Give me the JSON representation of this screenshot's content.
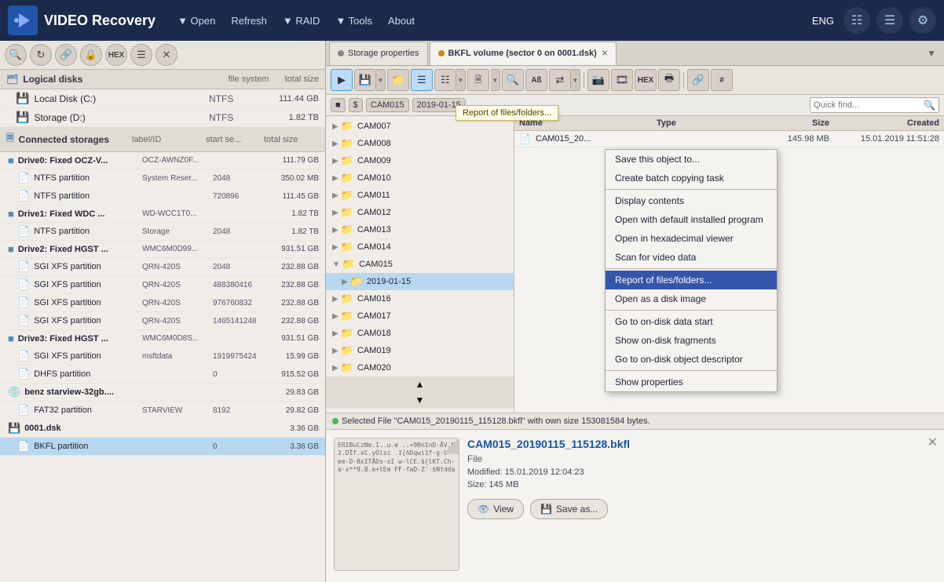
{
  "app": {
    "title": "VIDEO Recovery",
    "lang": "ENG"
  },
  "menu": {
    "items": [
      {
        "label": "▼ Open",
        "id": "open"
      },
      {
        "label": "Refresh",
        "id": "refresh"
      },
      {
        "label": "▼ RAID",
        "id": "raid"
      },
      {
        "label": "▼ Tools",
        "id": "tools"
      },
      {
        "label": "About",
        "id": "about"
      }
    ]
  },
  "left": {
    "logical_disks": {
      "header": "Logical disks",
      "cols": [
        "file system",
        "total size"
      ],
      "items": [
        {
          "name": "Local Disk (C:)",
          "icon": "💾",
          "fs": "NTFS",
          "size": "111.44 GB",
          "indent": 0
        },
        {
          "name": "Storage (D:)",
          "icon": "💾",
          "fs": "NTFS",
          "size": "1.82 TB",
          "indent": 0
        }
      ]
    },
    "connected_storages": {
      "header": "Connected storages",
      "cols": [
        "label/ID",
        "start se...",
        "total size"
      ],
      "items": [
        {
          "name": "Drive0: Fixed OCZ-V...",
          "icon": "🖴",
          "id": "OCZ-AWNZ0F...",
          "start": "",
          "size": "111.79 GB",
          "indent": 0,
          "bold": true
        },
        {
          "name": "NTFS partition",
          "icon": "📄",
          "id": "System Reser...",
          "start": "2048",
          "size": "350.02 MB",
          "indent": 1
        },
        {
          "name": "NTFS partition",
          "icon": "📄",
          "id": "",
          "start": "720896",
          "size": "111.45 GB",
          "indent": 1
        },
        {
          "name": "Drive1: Fixed WDC ...",
          "icon": "🖴",
          "id": "WD-WCC1T0...",
          "start": "",
          "size": "1.82 TB",
          "indent": 0,
          "bold": true
        },
        {
          "name": "NTFS partition",
          "icon": "📄",
          "id": "Storage",
          "start": "2048",
          "size": "1.82 TB",
          "indent": 1
        },
        {
          "name": "Drive2: Fixed HGST ...",
          "icon": "🖴",
          "id": "WMC6M0D99...",
          "start": "",
          "size": "931.51 GB",
          "indent": 0,
          "bold": true
        },
        {
          "name": "SGI XFS partition",
          "icon": "📄",
          "id": "QRN-420S",
          "start": "2048",
          "size": "232.88 GB",
          "indent": 1
        },
        {
          "name": "SGI XFS partition",
          "icon": "📄",
          "id": "QRN-420S",
          "start": "488380416",
          "size": "232.88 GB",
          "indent": 1
        },
        {
          "name": "SGI XFS partition",
          "icon": "📄",
          "id": "QRN-420S",
          "start": "976760832",
          "size": "232.88 GB",
          "indent": 1
        },
        {
          "name": "SGI XFS partition",
          "icon": "📄",
          "id": "QRN-420S",
          "start": "1465141248",
          "size": "232.88 GB",
          "indent": 1
        },
        {
          "name": "Drive3: Fixed HGST ...",
          "icon": "🖴",
          "id": "WMC6M0D8S...",
          "start": "",
          "size": "931.51 GB",
          "indent": 0,
          "bold": true
        },
        {
          "name": "SGI XFS partition",
          "icon": "📄",
          "id": "msftdata",
          "start": "1919975424",
          "size": "15.99 GB",
          "indent": 1
        },
        {
          "name": "DHFS partition",
          "icon": "📄",
          "id": "",
          "start": "0",
          "size": "915.52 GB",
          "indent": 1
        },
        {
          "name": "benz starview-32gb....",
          "icon": "💿",
          "id": "",
          "start": "",
          "size": "29.83 GB",
          "indent": 0
        },
        {
          "name": "FAT32 partition",
          "icon": "📄",
          "id": "STARVIEW",
          "start": "8192",
          "size": "29.82 GB",
          "indent": 1
        },
        {
          "name": "0001.dsk",
          "icon": "💾",
          "id": "",
          "start": "",
          "size": "3.36 GB",
          "indent": 0
        },
        {
          "name": "BKFL partition",
          "icon": "📄",
          "id": "",
          "start": "0",
          "size": "3.36 GB",
          "indent": 1,
          "selected": true
        }
      ]
    }
  },
  "tabs": [
    {
      "id": "storage-props",
      "label": "Storage properties",
      "dot_color": "#888",
      "active": false,
      "closable": false
    },
    {
      "id": "bkfl-volume",
      "label": "BKFL volume (sector 0 on 0001.dsk)",
      "dot_color": "#cc8800",
      "active": true,
      "closable": true
    }
  ],
  "path": {
    "crumbs": [
      "▪",
      "$",
      "CAM015",
      "2019-01-15"
    ],
    "search_placeholder": "Quick find...",
    "tooltip": "Report of files/folders..."
  },
  "tree": {
    "items": [
      {
        "name": "CAM007",
        "expanded": false,
        "indent": 0
      },
      {
        "name": "CAM008",
        "expanded": false,
        "indent": 0
      },
      {
        "name": "CAM009",
        "expanded": false,
        "indent": 0
      },
      {
        "name": "CAM010",
        "expanded": false,
        "indent": 0
      },
      {
        "name": "CAM011",
        "expanded": false,
        "indent": 0
      },
      {
        "name": "CAM012",
        "expanded": false,
        "indent": 0
      },
      {
        "name": "CAM013",
        "expanded": false,
        "indent": 0
      },
      {
        "name": "CAM014",
        "expanded": false,
        "indent": 0
      },
      {
        "name": "CAM015",
        "expanded": true,
        "indent": 0
      },
      {
        "name": "2019-01-15",
        "expanded": false,
        "indent": 1,
        "selected": true
      },
      {
        "name": "CAM016",
        "expanded": false,
        "indent": 0
      },
      {
        "name": "CAM017",
        "expanded": false,
        "indent": 0
      },
      {
        "name": "CAM018",
        "expanded": false,
        "indent": 0
      },
      {
        "name": "CAM019",
        "expanded": false,
        "indent": 0
      },
      {
        "name": "CAM020",
        "expanded": false,
        "indent": 0
      }
    ]
  },
  "file_list": {
    "columns": [
      "Name",
      "Type",
      "Size",
      "Created"
    ],
    "items": [
      {
        "name": "CAM015_20...",
        "icon": "📄",
        "type": "",
        "size": "145.98 MB",
        "created": "15.01.2019 11:51:28",
        "extra": "15.01..."
      }
    ]
  },
  "context_menu": {
    "items": [
      {
        "label": "Save this object to...",
        "id": "save",
        "sep_after": false
      },
      {
        "label": "Create batch copying task",
        "id": "batch",
        "sep_after": true
      },
      {
        "label": "Display contents",
        "id": "display",
        "sep_after": false
      },
      {
        "label": "Open with default installed program",
        "id": "open-default",
        "sep_after": false
      },
      {
        "label": "Open in hexadecimal viewer",
        "id": "open-hex",
        "sep_after": false
      },
      {
        "label": "Scan for video data",
        "id": "scan-video",
        "sep_after": true
      },
      {
        "label": "Report of files/folders...",
        "id": "report",
        "highlighted": true,
        "sep_after": false
      },
      {
        "label": "Open as a disk image",
        "id": "open-disk",
        "sep_after": true
      },
      {
        "label": "Go to on-disk data start",
        "id": "goto-start",
        "sep_after": false
      },
      {
        "label": "Show on-disk fragments",
        "id": "show-frags",
        "sep_after": false
      },
      {
        "label": "Go to on-disk object descriptor",
        "id": "goto-desc",
        "sep_after": true
      },
      {
        "label": "Show properties",
        "id": "properties",
        "sep_after": false
      }
    ]
  },
  "status": {
    "text": "Selected File \"CAM015_20190115_115128.bkfl\" with own size 153081584 bytes."
  },
  "preview": {
    "filename": "CAM015_20190115_115128.bkfl",
    "filetype": "File",
    "modified": "Modified: 15.01.2019 12:04:23",
    "size": "Size: 145 MB",
    "thumb_text": "ERIBuCzNm.I..u.e\n..+9BnInD·ÅV.N\n2.DÏf.xC.yȮlsi\n.I{ΛDqwi1f·g·b·\nee-D·BxITÅDs·±I\nw-lCE.${lKT.Ch·\na·x**9.B.e+tEm\nFF·faD-Z'·$N†dda",
    "view_label": "View",
    "save_label": "Save as..."
  }
}
